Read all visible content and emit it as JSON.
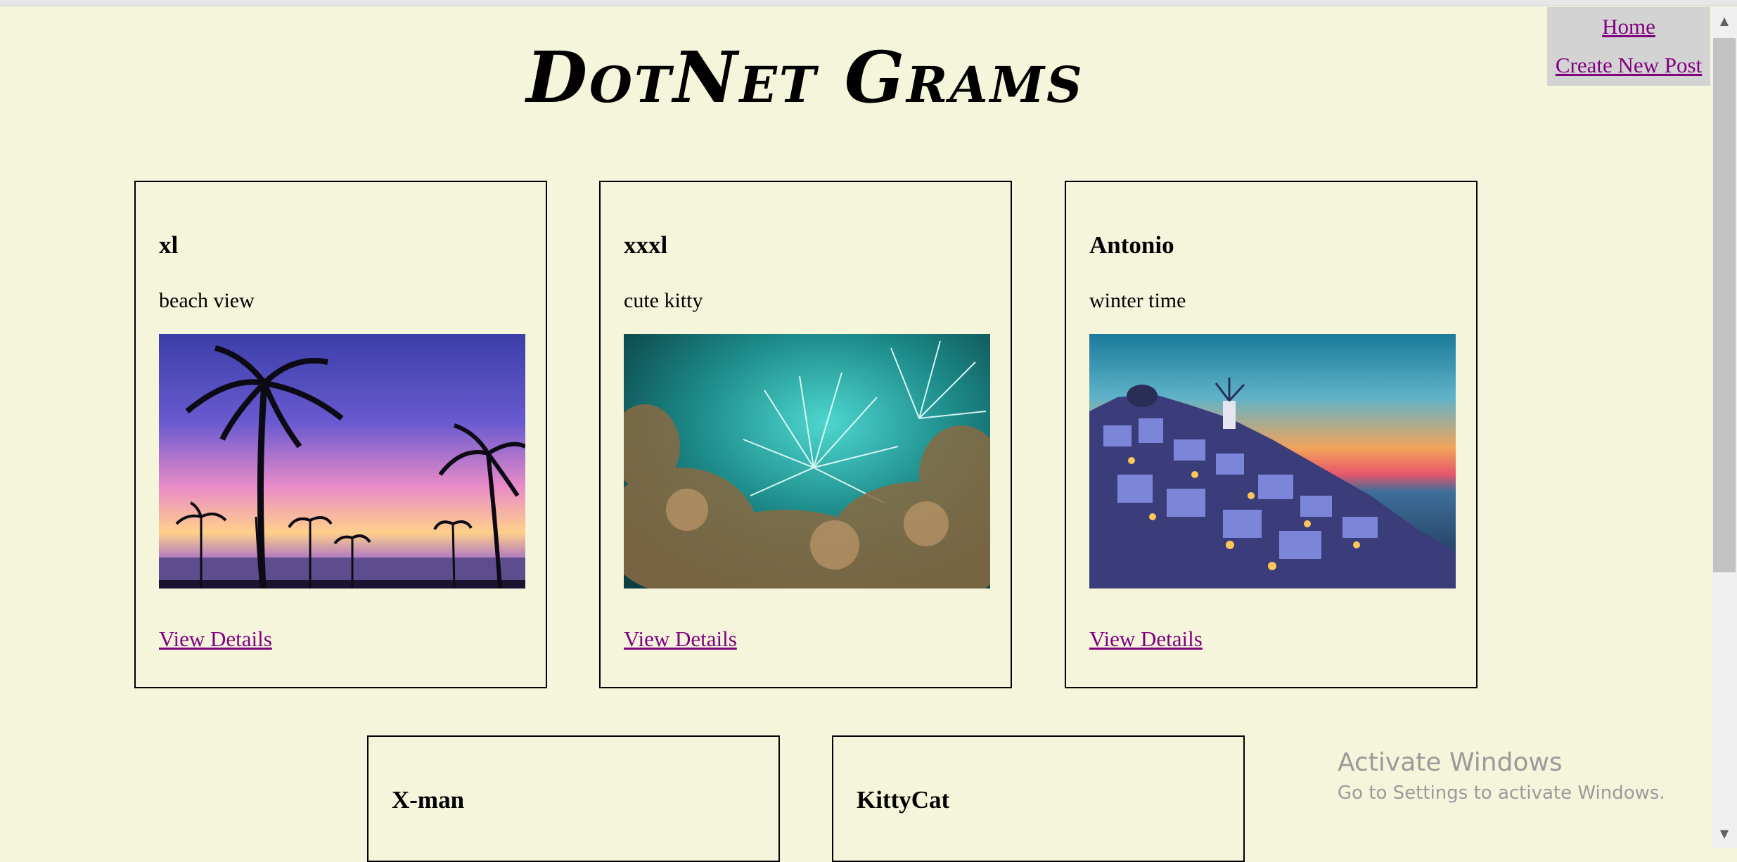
{
  "site": {
    "title": "DotNet Grams"
  },
  "nav": {
    "home_label": "Home",
    "create_label": "Create New Post"
  },
  "posts": [
    {
      "author": "xl",
      "caption": "beach view",
      "link_label": "View Details",
      "image": "palm-sunset-photo"
    },
    {
      "author": "xxxl",
      "caption": "cute kitty",
      "link_label": "View Details",
      "image": "fireworks-photo"
    },
    {
      "author": "Antonio",
      "caption": "winter time",
      "link_label": "View Details",
      "image": "santorini-dusk-photo"
    },
    {
      "author": "X-man"
    },
    {
      "author": "KittyCat"
    }
  ],
  "watermark": {
    "title": "Activate Windows",
    "subtitle": "Go to Settings to activate Windows."
  },
  "colors": {
    "page_background": "#f5f5dc",
    "nav_background": "#d3d3d3",
    "link": "#800080"
  }
}
